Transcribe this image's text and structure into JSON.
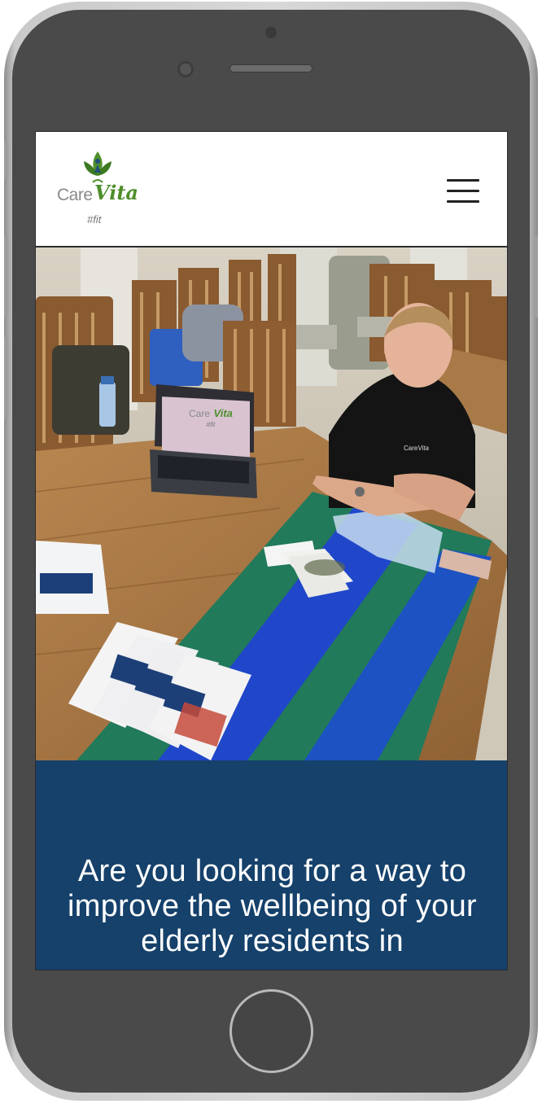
{
  "brand": {
    "name_part1": "Care",
    "name_part2": "Vita",
    "tagline": "#fit",
    "primary_color": "#15416b",
    "leaf_color": "#4e8f2b"
  },
  "header": {
    "menu_icon": "hamburger-menu-icon"
  },
  "hero": {
    "laptop_logo_part1": "Care",
    "laptop_logo_part2": "Vita",
    "laptop_logo_tagline": "#fit",
    "shirt_text_part1": "Care",
    "shirt_text_part2": "Vita"
  },
  "banner": {
    "headline": "Are you looking for a way to improve the wellbeing of your elderly residents in"
  }
}
